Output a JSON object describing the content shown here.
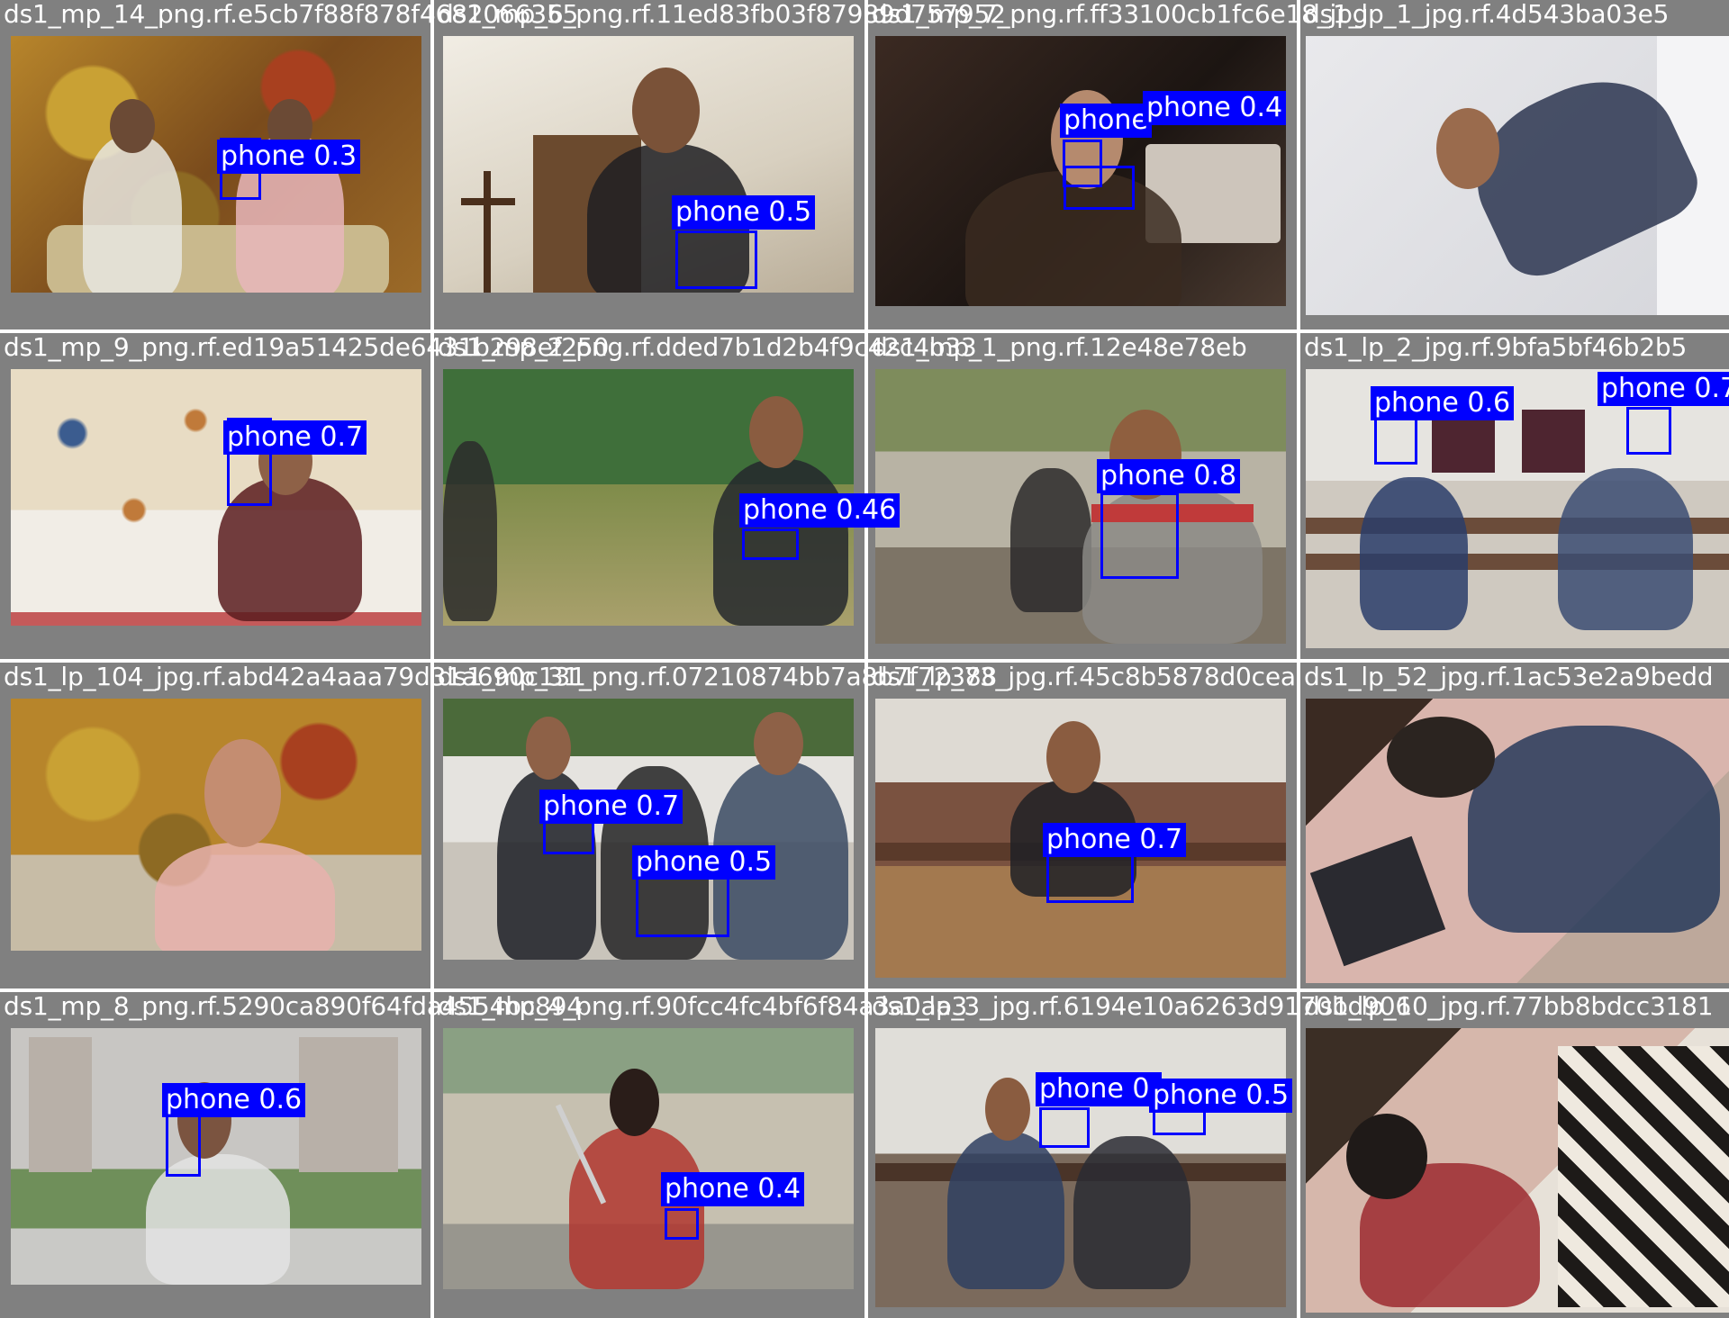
{
  "title": "",
  "colors": {
    "box": "#0000ff",
    "label_bg": "#0000ff",
    "label_text": "#ffffff",
    "cell_bg": "#808080",
    "filename_text": "#ffffff"
  },
  "tiles": [
    {
      "filename": "ds1_mp_14_png.rf.e5cb7f88f878f4682066355",
      "labels": [
        "phone 0.3"
      ],
      "scene": "warm-wallpaper"
    },
    {
      "filename": "ds1_mp_6_png.rf.11ed83fb03f87989d757952",
      "labels": [
        "phone 0.5"
      ],
      "scene": "indoor-room"
    },
    {
      "filename": "ds1_mp_7_png.rf.ff33100cb1fc6e18_jpg",
      "labels": [
        "phone 0.4",
        "phone"
      ],
      "scene": "dark-office"
    },
    {
      "filename": "ds1_lp_1_jpg.rf.4d543ba03e5",
      "labels": [],
      "scene": "bright-room"
    },
    {
      "filename": "ds1_mp_9_png.rf.ed19a51425de6431b298ef250",
      "labels": [
        "phone 0.7"
      ],
      "scene": "butterfly-wall"
    },
    {
      "filename": "ds1_mp_2_png.rf.dded7b1d2b4f9c42c4b33",
      "labels": [
        "phone 0.46"
      ],
      "scene": "outdoor-park"
    },
    {
      "filename": "ds1_mp_1_png.rf.12e48e78eb",
      "labels": [
        "phone 0.8"
      ],
      "scene": "outdoor-street"
    },
    {
      "filename": "ds1_lp_2_jpg.rf.9bfa5bf46b2b5",
      "labels": [
        "phone 0.6",
        "phone 0.7"
      ],
      "scene": "classroom"
    },
    {
      "filename": "ds1_lp_104_jpg.rf.abd42a4aaa79d31a690c131",
      "labels": [],
      "scene": "warm-wallpaper"
    },
    {
      "filename": "ds1_mp_31_png.rf.07210874bb7a8b7f72388",
      "labels": [
        "phone 0.7",
        "phone 0.5"
      ],
      "scene": "outdoor-group"
    },
    {
      "filename": "ds1_lp_73_jpg.rf.45c8b5878d0cea",
      "labels": [
        "phone 0.7"
      ],
      "scene": "classroom-bench"
    },
    {
      "filename": "ds1_lp_52_jpg.rf.1ac53e2a9bedd",
      "labels": [],
      "scene": "overhead-desk"
    },
    {
      "filename": "ds1_mp_8_png.rf.5290ca890f64fda4554bc894",
      "labels": [
        "phone 0.6"
      ],
      "scene": "buildings"
    },
    {
      "filename": "ds1_mp_4_png.rf.90fcc4fc4bf6f84a3a0aa3",
      "labels": [
        "phone 0.4"
      ],
      "scene": "selfie-wall"
    },
    {
      "filename": "ds1_lp_3_jpg.rf.6194e10a6263d9170bd906",
      "labels": [
        "phone 0.",
        "phone 0.5"
      ],
      "scene": "classroom-two"
    },
    {
      "filename": "ds1_lp_10_jpg.rf.77bb8bdcc3181",
      "labels": [],
      "scene": "overhead-sofa"
    }
  ]
}
